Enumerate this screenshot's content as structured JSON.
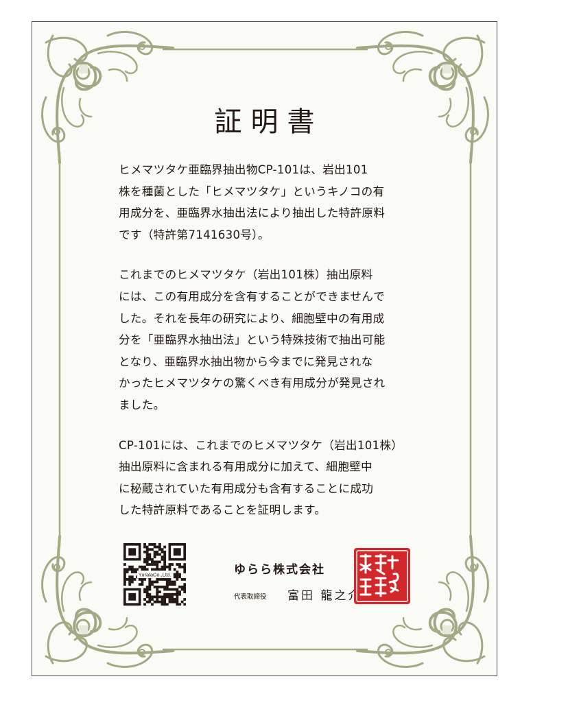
{
  "certificate": {
    "title": "証明書",
    "paragraphs": [
      [
        "ヒメマツタケ亜臨界抽出物CP-101は、岩出101",
        "株を種菌とした「ヒメマツタケ」というキノコの有",
        "用成分を、亜臨界水抽出法により抽出した特許原料",
        "です（特許第7141630号）。"
      ],
      [
        "これまでのヒメマツタケ（岩出101株）抽出原料",
        "には、この有用成分を含有することができませんで",
        "した。それを長年の研究により、細胞壁中の有用成",
        "分を「亜臨界水抽出法」という特殊技術で抽出可能",
        "となり、亜臨界水抽出物から今までに発見されな",
        "かったヒメマツタケの驚くべき有用成分が発見され",
        "ました。"
      ],
      [
        "CP-101には、これまでのヒメマツタケ（岩出101株）",
        "抽出原料に含まれる有用成分に加えて、細胞壁中",
        "に秘蔵されていた有用成分も含有することに成功",
        "した特許原料であることを証明します。"
      ]
    ],
    "qr_label": "YuralaCo.,Ltd.",
    "company_name": "ゆらら株式会社",
    "representative_title": "代表取締役",
    "representative_name": "富田 龍之介",
    "seal_text": "ゆらら株式会社印"
  },
  "colors": {
    "frame": "#a3a984",
    "ornament": "#a3a984",
    "seal": "#d2282b",
    "text": "#231815"
  }
}
